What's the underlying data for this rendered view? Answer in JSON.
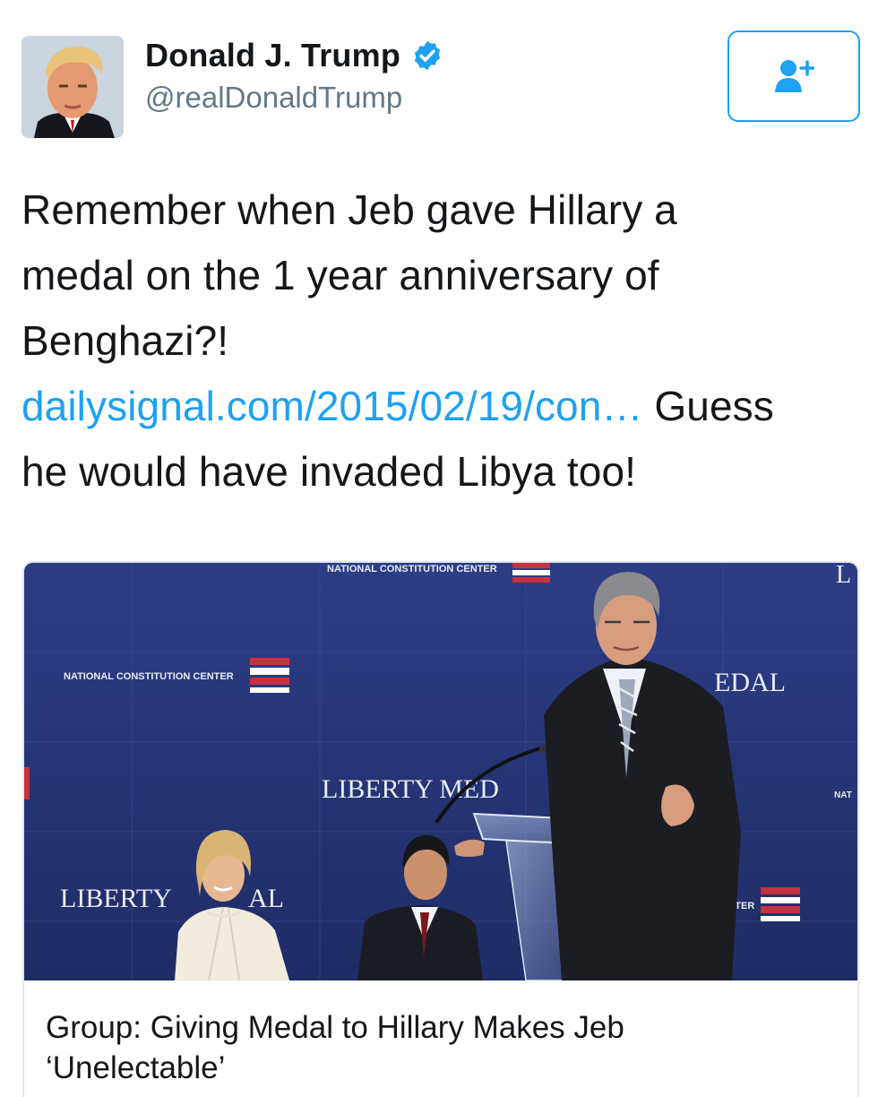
{
  "tweet": {
    "author": {
      "display_name": "Donald J. Trump",
      "handle": "@realDonaldTrump",
      "verified": true,
      "avatar_icon": "profile-photo"
    },
    "follow_button_icon": "add-user-icon",
    "text_lines": [
      "Remember when Jeb gave Hillary a",
      "medal on the 1 year anniversary of",
      "Benghazi?!"
    ],
    "link_text": "dailysignal.com/2015/02/19/con…",
    "text_after_link_1": " Guess",
    "text_after_link_2": "he would have invaded Libya too!"
  },
  "card": {
    "title_line_1": "Group: Giving Medal to Hillary Makes Jeb",
    "title_line_2": "‘Unelectable’",
    "image": {
      "backdrop_text": {
        "top_banner": "NATIONAL CONSTITUTION CENTER",
        "left_banner": "NATIONAL CONSTITUTION CENTER",
        "medal_right": "EDAL",
        "liberty_center": "LIBERTY MED",
        "liberty_left": "LIBERTY",
        "liberty_left_tail": "AL",
        "nat_right": "NAT",
        "enter_right": "ENTER",
        "corner": "L"
      }
    }
  },
  "colors": {
    "link": "#1da1f2",
    "verified": "#1da1f2",
    "backdrop": "#27367a",
    "text": "#14171a",
    "handle": "#657786"
  }
}
